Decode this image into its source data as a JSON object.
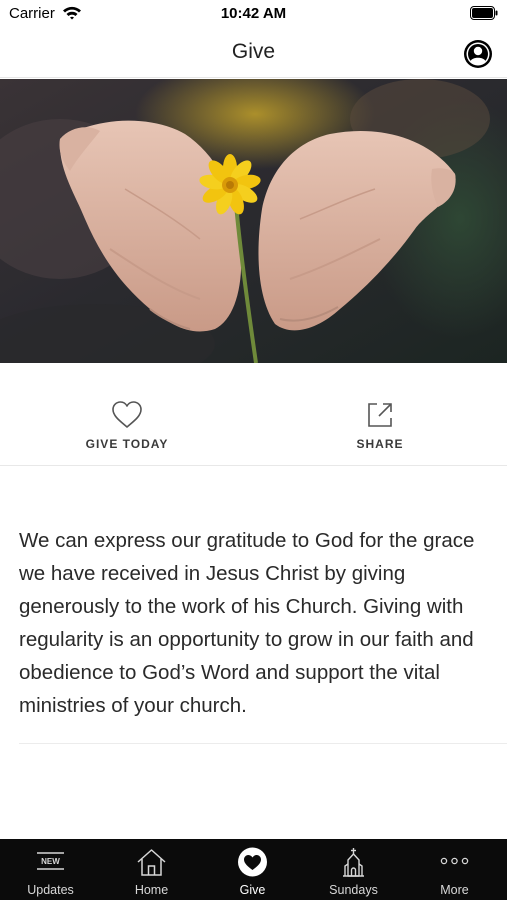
{
  "status_bar": {
    "carrier": "Carrier",
    "time": "10:42 AM"
  },
  "nav": {
    "title": "Give",
    "profile_icon": "person-circle-icon"
  },
  "hero": {
    "subject": "open-hands-yellow-flower"
  },
  "actions": [
    {
      "label": "GIVE TODAY",
      "icon": "heart-icon"
    },
    {
      "label": "SHARE",
      "icon": "share-icon"
    }
  ],
  "body": {
    "text": "We can express our gratitude to God for the grace we have received in Jesus Christ by giving generously to the work of his Church. Giving with regularity is an opportunity to grow in our faith and obedience to God’s Word and support the vital ministries of your church."
  },
  "tabs": [
    {
      "label": "Updates",
      "icon": "new-badge-icon",
      "badge": "NEW",
      "active": false
    },
    {
      "label": "Home",
      "icon": "house-icon",
      "active": false
    },
    {
      "label": "Give",
      "icon": "heart-circle-icon",
      "active": true
    },
    {
      "label": "Sundays",
      "icon": "church-icon",
      "active": false
    },
    {
      "label": "More",
      "icon": "ellipsis-icon",
      "active": false
    }
  ],
  "colors": {
    "tab_bar_background": "#0b0b0b",
    "accent_flower": "#f2c40f",
    "text": "#222222"
  }
}
